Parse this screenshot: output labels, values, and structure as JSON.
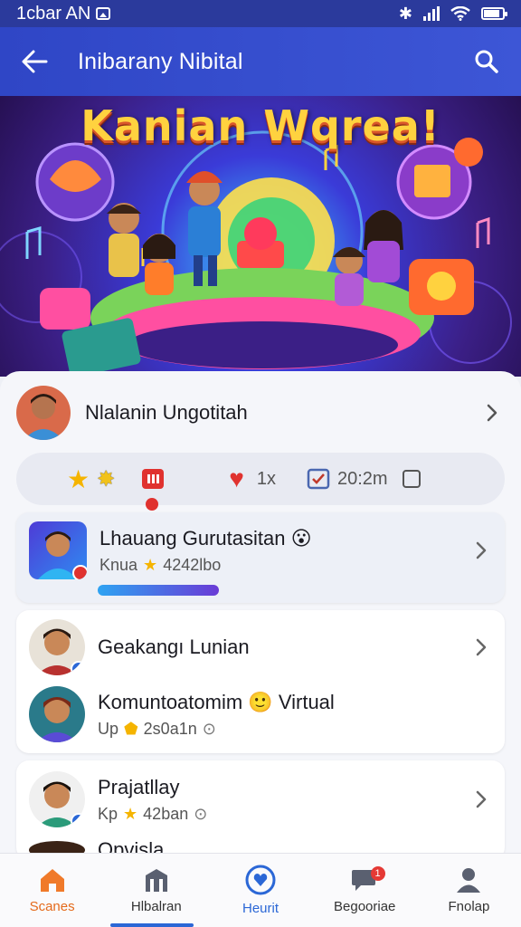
{
  "status_bar": {
    "time": "1cbar AN"
  },
  "app_bar": {
    "title": "Inibarany Nibital"
  },
  "banner": {
    "title": "Kanian Wqrea!"
  },
  "profile": {
    "name": "Nlalanin Ungotitah"
  },
  "stats": {
    "likes": "1x",
    "time": "20:2m"
  },
  "list": [
    {
      "title": "Lhauang Gurutasitan",
      "emoji": "😮",
      "subtitle_prefix": "Knua",
      "subtitle_value": "4242lbo",
      "progress": 0.25
    },
    {
      "title": "Geakangı Lunian"
    },
    {
      "title": "Komuntoatomim",
      "emoji": "🙂",
      "title_suffix": "Virtual",
      "subtitle_prefix": "Up",
      "subtitle_value": "2s0a1n"
    },
    {
      "title": "Prajatllay",
      "subtitle_prefix": "Kp",
      "subtitle_value": "42ban"
    },
    {
      "title": "Opvisla"
    }
  ],
  "nav": [
    {
      "label": "Scanes",
      "icon": "home-icon",
      "active": true
    },
    {
      "label": "Hlbalran",
      "icon": "store-icon",
      "active": false
    },
    {
      "label": "Heurit",
      "icon": "heart-badge-icon",
      "active": false
    },
    {
      "label": "Begooriae",
      "icon": "chat-icon",
      "active": false,
      "badge": "1"
    },
    {
      "label": "Fnolap",
      "icon": "profile-icon",
      "active": false
    }
  ],
  "colors": {
    "primary": "#2f46c6",
    "accent": "#e46a1b",
    "progress_start": "#2ea3f2",
    "progress_end": "#6a3bd6"
  }
}
